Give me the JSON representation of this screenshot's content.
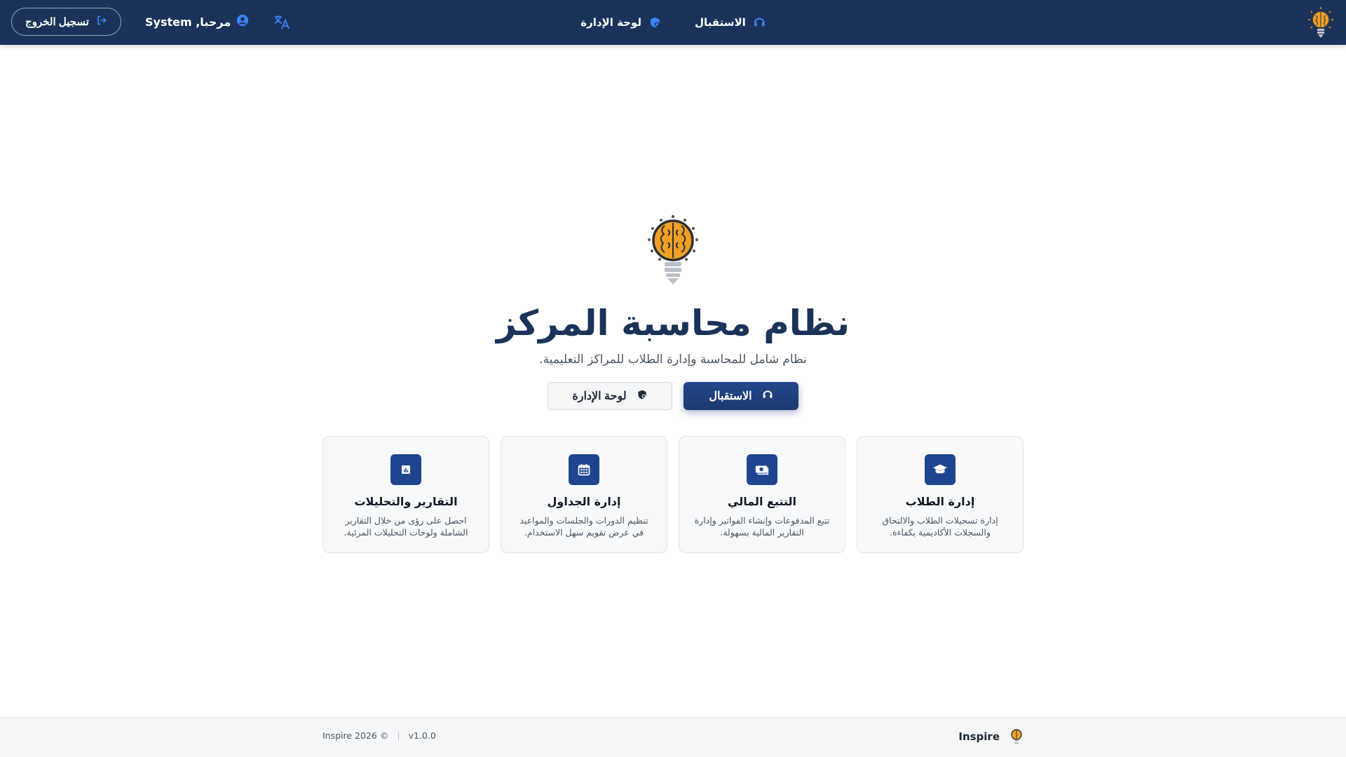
{
  "topbar": {
    "logo_icon": "brain-bulb-logo-icon",
    "nav": [
      {
        "label": "الاستقبال",
        "icon": "headset-icon"
      },
      {
        "label": "لوحة الإدارة",
        "icon": "shield-icon"
      }
    ],
    "language_icon": "translate-icon",
    "greeting": "مرحبا, System",
    "user_icon": "user-circle-icon",
    "logout_label": "تسجيل الخروج",
    "logout_icon": "logout-icon"
  },
  "hero": {
    "title": "نظام محاسبة المركز",
    "subtitle": "نظام شامل للمحاسبة وإدارة الطلاب للمراكز التعليمية.",
    "primary_button": "الاستقبال",
    "secondary_button": "لوحة الإدارة"
  },
  "features": [
    {
      "title": "إدارة الطلاب",
      "desc": "إدارة تسجيلات الطلاب والالتحاق والسجلات الأكاديمية بكفاءة.",
      "icon": "graduation-cap-icon"
    },
    {
      "title": "التتبع المالي",
      "desc": "تتبع المدفوعات وإنشاء الفواتير وإدارة التقارير المالية بسهولة.",
      "icon": "money-icon"
    },
    {
      "title": "إدارة الجداول",
      "desc": "تنظيم الدورات والجلسات والمواعيد في عرض تقويم سهل الاستخدام.",
      "icon": "calendar-icon"
    },
    {
      "title": "التقارير والتحليلات",
      "desc": "احصل على رؤى من خلال التقارير الشاملة ولوحات التحليلات المرئية.",
      "icon": "chart-icon"
    }
  ],
  "footer": {
    "brand": "Inspire",
    "copyright": "Inspire 2026 ©",
    "version": "v1.0.0"
  },
  "colors": {
    "navbar": "#1b335a",
    "primary": "#1f4590",
    "accent_blue": "#3b82f6",
    "logo_orange": "#f0a028"
  }
}
